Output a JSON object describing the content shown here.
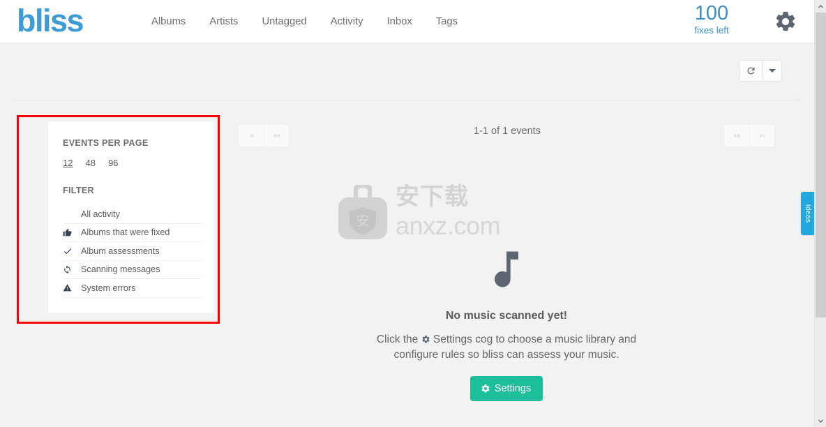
{
  "header": {
    "brand": "bliss",
    "nav_items": [
      {
        "label": "Albums",
        "name": "nav-albums"
      },
      {
        "label": "Artists",
        "name": "nav-artists"
      },
      {
        "label": "Untagged",
        "name": "nav-untagged"
      },
      {
        "label": "Activity",
        "name": "nav-activity"
      },
      {
        "label": "Inbox",
        "name": "nav-inbox"
      },
      {
        "label": "Tags",
        "name": "nav-tags"
      }
    ],
    "fixes_count": "100",
    "fixes_label": "fixes left",
    "settings_gear_icon": "gear-icon",
    "brand_color": "#3e9bd6",
    "fixes_color": "#3e8fc4"
  },
  "toolbar": {
    "refresh_icon": "refresh-icon",
    "dropdown_icon": "caret-down-icon"
  },
  "sidebar": {
    "events_per_page_title": "EVENTS PER PAGE",
    "per_page_options": [
      {
        "label": "12",
        "active": true
      },
      {
        "label": "48",
        "active": false
      },
      {
        "label": "96",
        "active": false
      }
    ],
    "filter_title": "FILTER",
    "filters": [
      {
        "label": "All activity",
        "icon": "none"
      },
      {
        "label": "Albums that were fixed",
        "icon": "thumbs-up-icon"
      },
      {
        "label": "Album assessments",
        "icon": "check-icon"
      },
      {
        "label": "Scanning messages",
        "icon": "sync-icon"
      },
      {
        "label": "System errors",
        "icon": "warning-triangle-icon"
      }
    ],
    "highlight_color": "#fc0000"
  },
  "main": {
    "events_count_text": "1-1 of 1 events",
    "pager_first_icon": "skip-to-first-icon",
    "pager_prev_icon": "previous-icon",
    "pager_next_icon": "next-icon",
    "pager_last_icon": "skip-to-last-icon",
    "empty_music_icon": "music-note-icon",
    "empty_title": "No music scanned yet!",
    "empty_desc_before": "Click the ",
    "empty_desc_after": " Settings cog to choose a music library and configure rules so bliss can assess your music.",
    "settings_button_label": "Settings",
    "settings_button_color": "#1dbf9b"
  },
  "watermark": {
    "text_cn": "安下载",
    "text_domain": "anxz.com",
    "bag_label": "安"
  },
  "ideas_tab": {
    "label": "Ideas",
    "color": "#23a8dd"
  }
}
